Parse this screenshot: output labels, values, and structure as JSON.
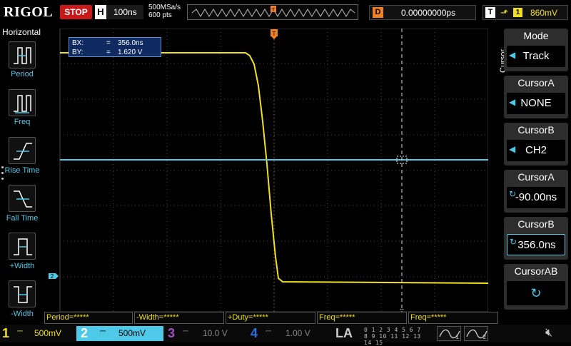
{
  "brand": "RIGOL",
  "run_status": "STOP",
  "horizontal": {
    "label": "H",
    "timebase": "100ns",
    "sample_rate": "500MSa/s",
    "points": "600 pts"
  },
  "delay": {
    "label": "D",
    "value": "0.00000000ps"
  },
  "trigger": {
    "label": "T",
    "level": "860mV",
    "slope_symbol": "↑̄",
    "source": "1"
  },
  "left_menu": {
    "title": "Horizontal",
    "items": [
      {
        "label": "Period",
        "icon": "period-icon"
      },
      {
        "label": "Freq",
        "icon": "freq-icon"
      },
      {
        "label": "Rise Time",
        "icon": "rise-time-icon"
      },
      {
        "label": "Fall Time",
        "icon": "fall-time-icon"
      },
      {
        "label": "+Width",
        "icon": "positive-width-icon"
      },
      {
        "label": "-Width",
        "icon": "negative-width-icon"
      }
    ]
  },
  "cursor_readout": {
    "bx_label": "BX:",
    "bx_value": "356.0ns",
    "by_label": "BY:",
    "by_value": "1.620 V"
  },
  "right_menu": {
    "title": "Cursor",
    "items": [
      {
        "label": "Mode",
        "value": "Track",
        "control": "arrow"
      },
      {
        "label": "CursorA",
        "value": "NONE",
        "control": "arrow"
      },
      {
        "label": "CursorB",
        "value": "CH2",
        "control": "arrow"
      },
      {
        "label": "CursorA",
        "value": "-90.00ns",
        "control": "knob"
      },
      {
        "label": "CursorB",
        "value": "356.0ns",
        "control": "knob"
      },
      {
        "label": "CursorAB",
        "value": "",
        "control": "knob"
      }
    ]
  },
  "measurements": [
    {
      "label": "Period=*****"
    },
    {
      "label": "-Width=*****"
    },
    {
      "label": "+Duty=*****"
    },
    {
      "label": "Freq=*****"
    },
    {
      "label": "Freq=*****"
    }
  ],
  "channels": [
    {
      "num": "1",
      "scale": "500mV",
      "color": "#f0e020",
      "active": true
    },
    {
      "num": "2",
      "scale": "500mV",
      "color": "#4fc9e8",
      "active": true
    },
    {
      "num": "3",
      "scale": "10.0 V",
      "color": "#a050c0",
      "active": false
    },
    {
      "num": "4",
      "scale": "1.00 V",
      "color": "#3070e0",
      "active": false
    }
  ],
  "logic_analyzer": {
    "label": "LA",
    "digits_row1": "0 1 2 3  4 5 6 7",
    "digits_row2": "8 9 10 11 12 13 14 15"
  },
  "generators": [
    "1",
    "2"
  ],
  "colors": {
    "ch1": "#f0e020",
    "ch2": "#4fc9e8",
    "stop": "#c81818",
    "trigger": "#f08020",
    "accent": "#4fc9e8"
  }
}
